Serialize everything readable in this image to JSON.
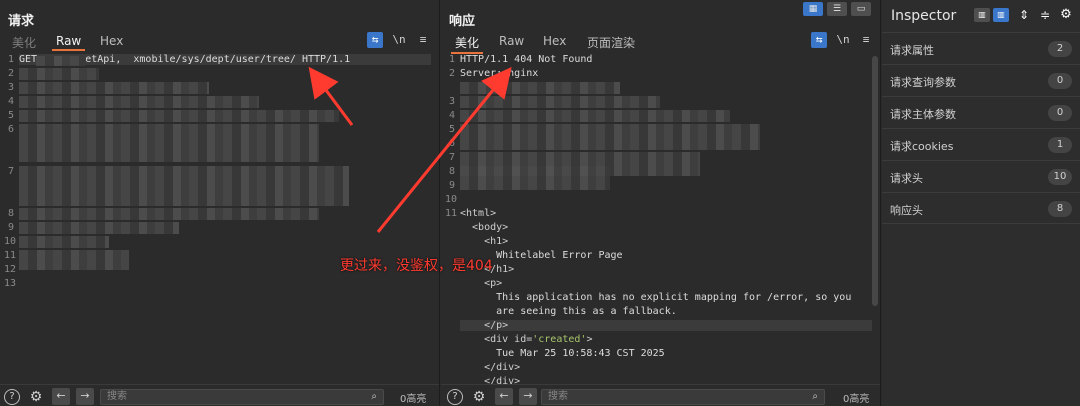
{
  "request": {
    "title": "请求",
    "tabs": [
      "美化",
      "Raw",
      "Hex"
    ],
    "active_tab": "Raw",
    "wrap_label": "\\n",
    "menu_label": "≡",
    "line_numbers": [
      "1",
      "2",
      "3",
      "4",
      "5",
      "6",
      "7",
      "8",
      "9",
      "10",
      "11",
      "12",
      "13"
    ],
    "line1": "GET        etApi,  xmobile/sys/dept/user/tree/ HTTP/1.1",
    "footer": {
      "search_placeholder": "搜索",
      "hits": "0高亮"
    }
  },
  "response": {
    "title": "响应",
    "tabs": [
      "美化",
      "Raw",
      "Hex",
      "页面渲染"
    ],
    "active_tab": "美化",
    "wrap_label": "\\n",
    "menu_label": "≡",
    "line_numbers": [
      "1",
      "2",
      "3",
      "4",
      "5",
      "6",
      "7",
      "8",
      "9",
      "10",
      "11"
    ],
    "lines": {
      "l1": "HTTP/1.1 404 Not Found",
      "l2": "Server: nginx",
      "l11": "<html>",
      "body_open": "  <body>",
      "h1_open": "    <h1>",
      "h1_text": "      Whitelabel Error Page",
      "h1_close": "    </h1>",
      "p_open": "    <p>",
      "p_text1": "      This application has no explicit mapping for /error, so you",
      "p_text2": "      are seeing this as a fallback.",
      "p_close": "    </p>",
      "div_open_a": "    <div id=",
      "div_id": "'created'",
      "div_open_b": ">",
      "div_text": "      Tue Mar 25 10:58:43 CST 2025",
      "div_close": "    </div>",
      "div_close2": "    </div>"
    },
    "footer": {
      "search_placeholder": "搜索",
      "hits": "0高亮"
    }
  },
  "inspector": {
    "title": "Inspector",
    "rows": [
      {
        "label": "请求属性",
        "count": "2"
      },
      {
        "label": "请求查询参数",
        "count": "0"
      },
      {
        "label": "请求主体参数",
        "count": "0"
      },
      {
        "label": "请求cookies",
        "count": "1"
      },
      {
        "label": "请求头",
        "count": "10"
      },
      {
        "label": "响应头",
        "count": "8"
      }
    ]
  },
  "annotation": "更过来，没鉴权，是404",
  "colors": {
    "accent": "#e8743b",
    "toggle_blue": "#3a76c9",
    "arrow_red": "#ff3b30"
  }
}
